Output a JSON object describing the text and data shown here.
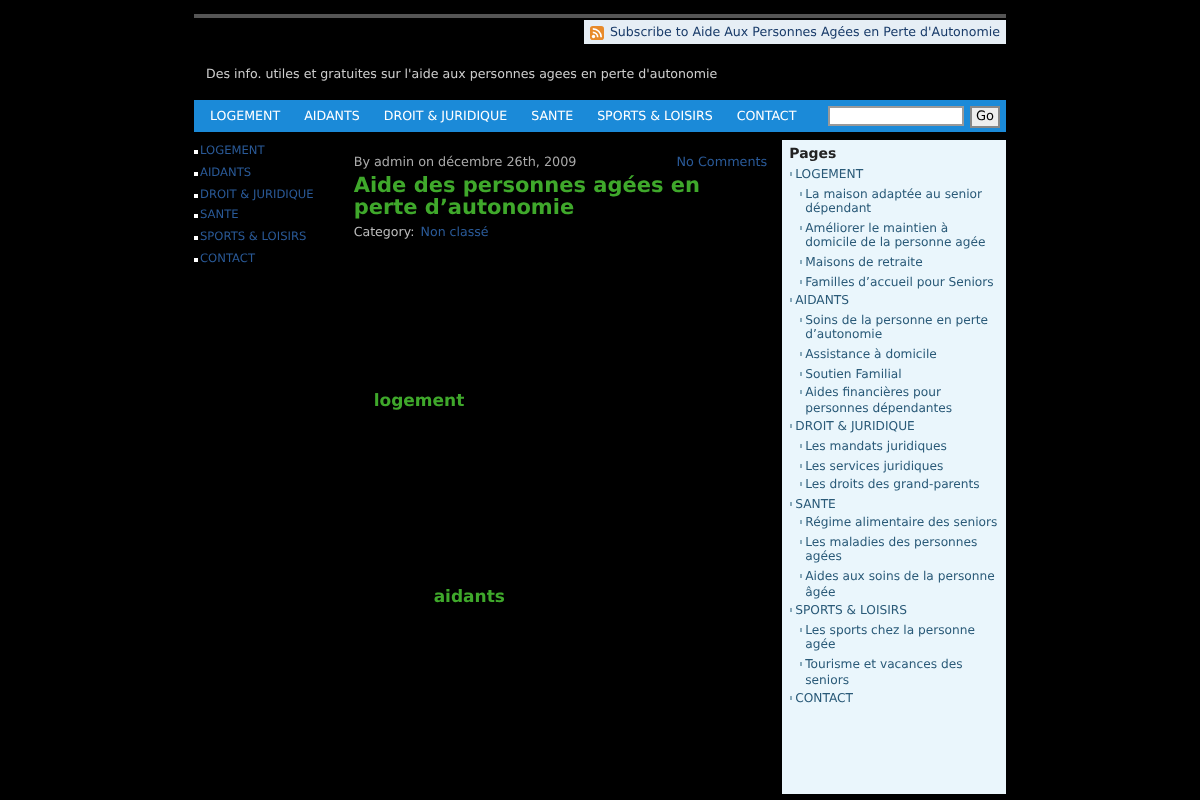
{
  "header": {
    "subscribe": "Subscribe to Aide Aux Personnes Agées en Perte d'Autonomie",
    "tagline": "Des info. utiles et gratuites sur l'aide aux personnes agees en perte d'autonomie"
  },
  "nav": {
    "items": [
      "LOGEMENT",
      "AIDANTS",
      "DROIT & JURIDIQUE",
      "SANTE",
      "SPORTS & LOISIRS",
      "CONTACT"
    ],
    "search_button": "Go"
  },
  "left_menu": [
    "LOGEMENT",
    "AIDANTS",
    "DROIT & JURIDIQUE",
    "SANTE",
    "SPORTS & LOISIRS",
    "CONTACT"
  ],
  "post": {
    "meta": "By admin on décembre 26th, 2009",
    "comments": "No Comments",
    "title": "Aide des personnes agées en perte d’autonomie",
    "category_label": "Category:",
    "category": "Non classé",
    "tags": [
      "logement",
      "aidants"
    ]
  },
  "sidebar": {
    "title": "Pages",
    "items": [
      {
        "label": "LOGEMENT",
        "children": [
          "La maison adaptée au senior dépendant",
          "Améliorer le maintien à domicile de la personne agée",
          "Maisons de retraite",
          "Familles d’accueil pour Seniors"
        ]
      },
      {
        "label": "AIDANTS",
        "children": [
          "Soins de la personne en perte d’autonomie",
          "Assistance à domicile",
          "Soutien Familial",
          "Aides financières pour personnes dépendantes"
        ]
      },
      {
        "label": "DROIT & JURIDIQUE",
        "children": [
          "Les mandats juridiques",
          "Les services juridiques",
          "Les droits des grand-parents"
        ]
      },
      {
        "label": "SANTE",
        "children": [
          "Régime alimentaire des seniors",
          "Les maladies des personnes agées",
          "Aides aux soins de la personne âgée"
        ]
      },
      {
        "label": "SPORTS & LOISIRS",
        "children": [
          "Les sports chez la personne agée",
          "Tourisme et vacances des seniors"
        ]
      },
      {
        "label": "CONTACT"
      }
    ]
  }
}
